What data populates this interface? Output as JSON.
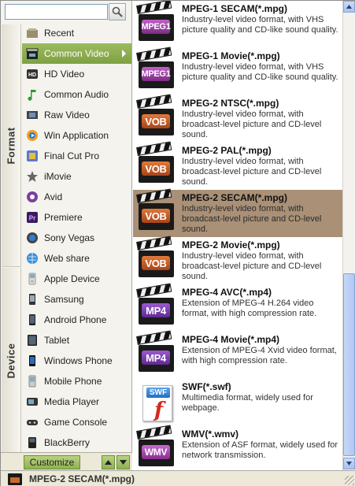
{
  "search": {
    "value": "",
    "icon": "magnifier-icon"
  },
  "groups": {
    "format_label": "Format",
    "device_label": "Device"
  },
  "format_categories": [
    {
      "label": "Recent",
      "icon": "recent-icon"
    },
    {
      "label": "Common Video",
      "icon": "clapper-icon",
      "selected": true
    },
    {
      "label": "HD Video",
      "icon": "hd-icon"
    },
    {
      "label": "Common Audio",
      "icon": "music-note-icon"
    },
    {
      "label": "Raw Video",
      "icon": "film-icon"
    },
    {
      "label": "Win Application",
      "icon": "windows-media-icon"
    },
    {
      "label": "Final Cut Pro",
      "icon": "final-cut-pro-icon"
    },
    {
      "label": "iMovie",
      "icon": "star-icon"
    },
    {
      "label": "Avid",
      "icon": "avid-icon"
    },
    {
      "label": "Premiere",
      "icon": "premiere-icon"
    },
    {
      "label": "Sony Vegas",
      "icon": "vegas-icon"
    },
    {
      "label": "Web share",
      "icon": "globe-icon"
    }
  ],
  "device_categories": [
    {
      "label": "Apple Device",
      "icon": "ipod-icon"
    },
    {
      "label": "Samsung",
      "icon": "phone-icon"
    },
    {
      "label": "Android Phone",
      "icon": "android-phone-icon"
    },
    {
      "label": "Tablet",
      "icon": "tablet-icon"
    },
    {
      "label": "Windows Phone",
      "icon": "windows-phone-icon"
    },
    {
      "label": "Mobile Phone",
      "icon": "mobile-phone-icon"
    },
    {
      "label": "Media Player",
      "icon": "media-player-icon"
    },
    {
      "label": "Game Console",
      "icon": "game-console-icon"
    },
    {
      "label": "BlackBerry",
      "icon": "blackberry-icon"
    }
  ],
  "customize_label": "Customize",
  "formats": [
    {
      "name": "MPEG-1 SECAM(*.mpg)",
      "desc": "Industry-level video format, with VHS picture quality and CD-like sound quality.",
      "badge": "MPEG1",
      "style": "mpeg1"
    },
    {
      "name": "MPEG-1 Movie(*.mpg)",
      "desc": "Industry-level video format, with VHS picture quality and CD-like sound quality.",
      "badge": "MPEG1",
      "style": "mpeg1"
    },
    {
      "name": "MPEG-2 NTSC(*.mpg)",
      "desc": "Industry-level video format, with broadcast-level picture and CD-level sound.",
      "badge": "VOB",
      "style": "vob"
    },
    {
      "name": "MPEG-2 PAL(*.mpg)",
      "desc": "Industry-level video format, with broadcast-level picture and CD-level sound.",
      "badge": "VOB",
      "style": "vob"
    },
    {
      "name": "MPEG-2 SECAM(*.mpg)",
      "desc": "Industry-level video format, with broadcast-level picture and CD-level sound.",
      "badge": "VOB",
      "style": "vob",
      "selected": true
    },
    {
      "name": "MPEG-2 Movie(*.mpg)",
      "desc": "Industry-level video format, with broadcast-level picture and CD-level sound.",
      "badge": "VOB",
      "style": "vob"
    },
    {
      "name": "MPEG-4 AVC(*.mp4)",
      "desc": "Extension of MPEG-4 H.264 video format, with high compression rate.",
      "badge": "MP4",
      "style": "mp4"
    },
    {
      "name": "MPEG-4 Movie(*.mp4)",
      "desc": "Extension of MPEG-4 Xvid video format, with high compression rate.",
      "badge": "MP4",
      "style": "mp4"
    },
    {
      "name": "SWF(*.swf)",
      "desc": "Multimedia format, widely used for webpage.",
      "badge": "SWF",
      "style": "swf"
    },
    {
      "name": "WMV(*.wmv)",
      "desc": "Extension of ASF format, widely used for network transmission.",
      "badge": "WMV",
      "style": "wmv"
    }
  ],
  "status": {
    "text": "MPEG-2 SECAM(*.mpg)",
    "icon": "vob-clapper-icon"
  },
  "colors": {
    "selected_category": "#8fb150",
    "selected_format": "#a99076"
  }
}
